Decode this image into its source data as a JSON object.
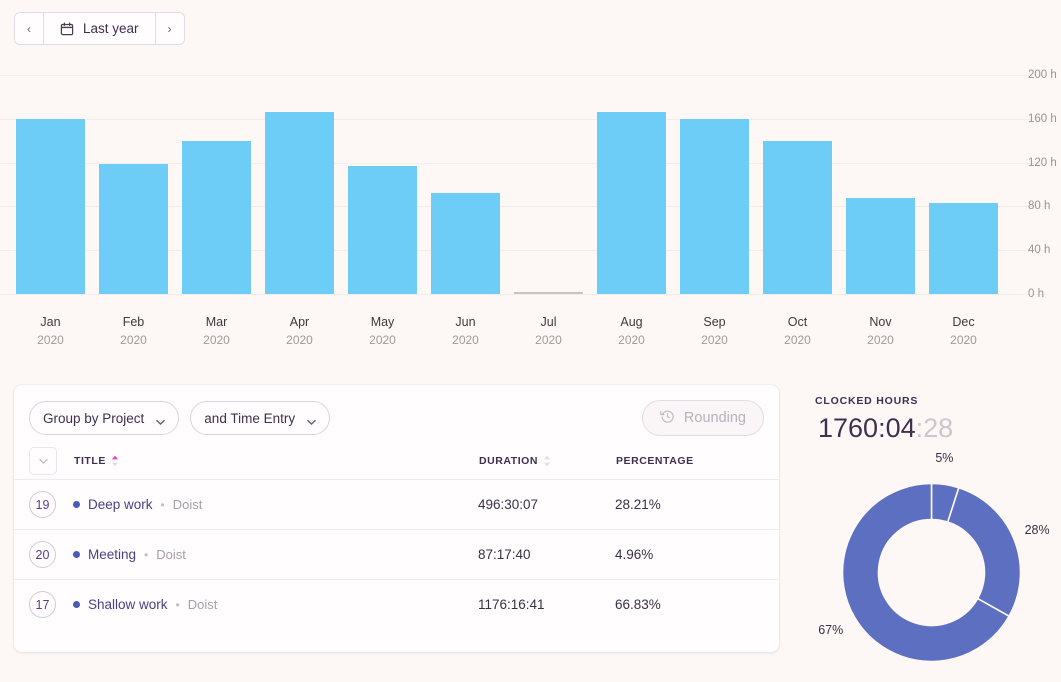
{
  "date_nav": {
    "prev_label": "‹",
    "next_label": "›",
    "range_label": "Last year",
    "calendar_icon": "calendar-icon"
  },
  "chart_data": {
    "type": "bar",
    "title": "",
    "xlabel": "",
    "ylabel": "",
    "ylim": [
      0,
      200
    ],
    "grid": true,
    "legend": "none",
    "unit": "h",
    "categories": [
      "Jan",
      "Feb",
      "Mar",
      "Apr",
      "May",
      "Jun",
      "Jul",
      "Aug",
      "Sep",
      "Oct",
      "Nov",
      "Dec"
    ],
    "category_years": [
      "2020",
      "2020",
      "2020",
      "2020",
      "2020",
      "2020",
      "2020",
      "2020",
      "2020",
      "2020",
      "2020",
      "2020"
    ],
    "values": [
      160,
      119,
      140,
      166,
      117,
      92,
      0,
      166,
      160,
      140,
      88,
      83
    ],
    "ytick_labels": [
      "200 h",
      "160 h",
      "120 h",
      "80 h",
      "40 h",
      "0 h"
    ],
    "ytick_values": [
      200,
      160,
      120,
      80,
      40,
      0
    ],
    "bar_color": "#6dcdf7"
  },
  "controls": {
    "group_by": {
      "label": "Group by Project",
      "chevron": "chevron-down-icon"
    },
    "and_by": {
      "label": "and Time Entry",
      "chevron": "chevron-down-icon"
    },
    "rounding": {
      "label": "Rounding",
      "icon": "clock-rotate-icon",
      "disabled": true
    }
  },
  "table": {
    "collapse_icon": "chevron-down-icon",
    "columns": [
      {
        "key": "title",
        "label": "TITLE",
        "sort": "asc",
        "sort_icon": "sort-arrows-icon"
      },
      {
        "key": "duration",
        "label": "DURATION",
        "sort": "none",
        "sort_icon": "sort-arrows-icon"
      },
      {
        "key": "percentage",
        "label": "PERCENTAGE",
        "sort": "none",
        "sort_icon": ""
      }
    ],
    "rows": [
      {
        "count": "19",
        "title": "Deep work",
        "separator": "•",
        "project": "Doist",
        "duration": "496:30:07",
        "percentage": "28.21%"
      },
      {
        "count": "20",
        "title": "Meeting",
        "separator": "•",
        "project": "Doist",
        "duration": "87:17:40",
        "percentage": "4.96%"
      },
      {
        "count": "17",
        "title": "Shallow work",
        "separator": "•",
        "project": "Doist",
        "duration": "1176:16:41",
        "percentage": "66.83%"
      }
    ]
  },
  "clocked": {
    "label": "CLOCKED HOURS",
    "value_main": "1760:04",
    "value_seconds": ":28",
    "donut": {
      "type": "pie",
      "color": "#5c6fc1",
      "slices": [
        {
          "label": "5%",
          "value": 4.96
        },
        {
          "label": "28%",
          "value": 28.21
        },
        {
          "label": "67%",
          "value": 66.83
        }
      ]
    }
  },
  "colors": {
    "background": "#fdf7f6",
    "bar": "#6dcdf7",
    "donut": "#5c6fc1",
    "accent_sort": "#e040c8",
    "text": "#3f2f4f"
  }
}
